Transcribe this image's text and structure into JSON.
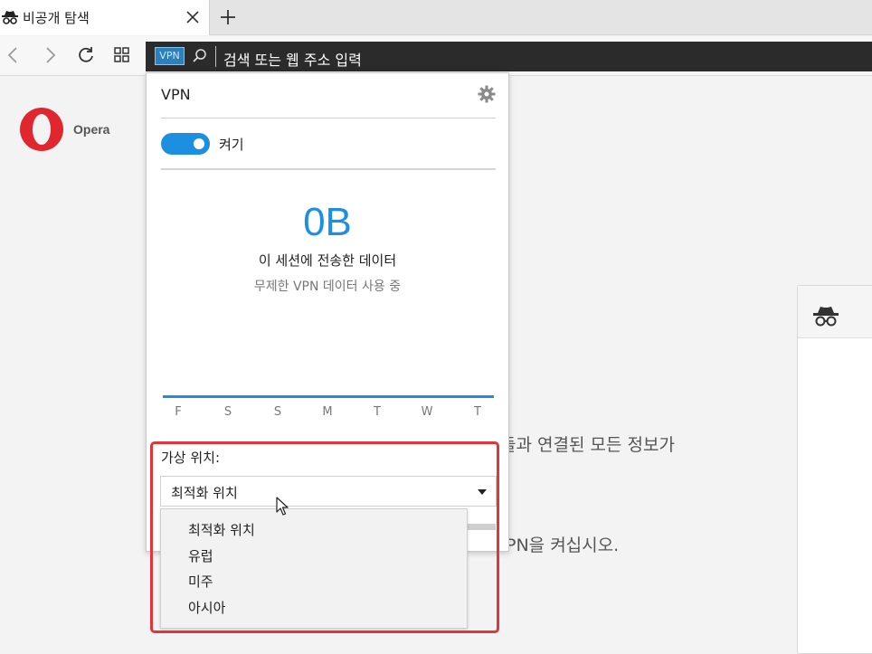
{
  "tab": {
    "title": "비공개 탐색",
    "icon": "incognito-icon"
  },
  "toolbar": {
    "vpn_badge": "VPN",
    "address_placeholder": "검색 또는 웹 주소 입력"
  },
  "speed_dial": {
    "logo_label": "Opera",
    "text_line1": "들과 연결된 모든 정보가",
    "text_line2": "PN을 켜십시오."
  },
  "vpn_popup": {
    "title": "VPN",
    "toggle_label": "켜기",
    "toggle_on": true,
    "data_amount": "0B",
    "data_title": "이 세션에 전송한 데이터",
    "data_subtitle": "무제한 VPN 데이터 사용 중",
    "days": [
      "F",
      "S",
      "S",
      "M",
      "T",
      "W",
      "T"
    ],
    "location_label": "가상 위치:",
    "location_selected": "최적화 위치",
    "location_options": [
      "최적화 위치",
      "유럽",
      "미주",
      "아시아"
    ]
  },
  "colors": {
    "accent": "#1d8fe1",
    "highlight": "#e0353b",
    "address_bar": "#2b2b2b"
  }
}
